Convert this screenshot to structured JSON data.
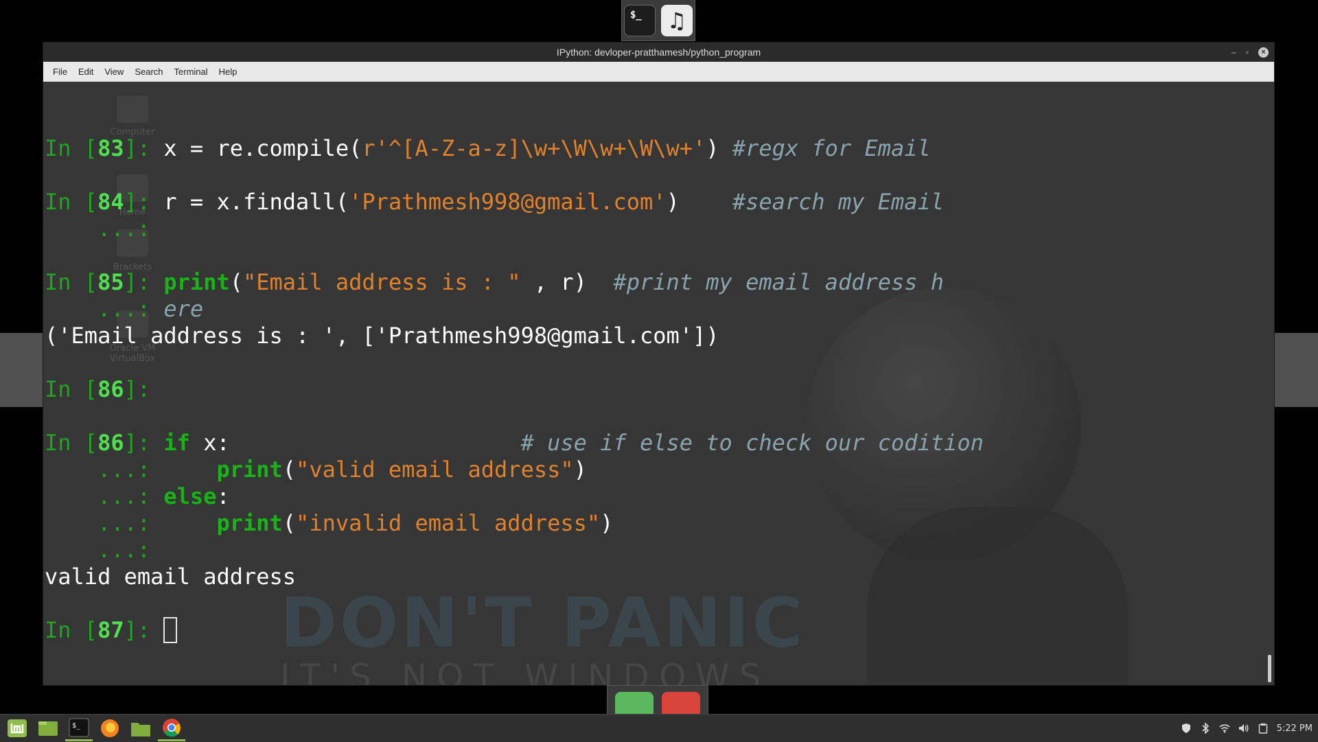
{
  "window": {
    "title": "IPython: devloper-pratthamesh/python_program",
    "controls": {
      "minimize": "–",
      "maximize": "▫",
      "close": "×"
    }
  },
  "menu": [
    "File",
    "Edit",
    "View",
    "Search",
    "Terminal",
    "Help"
  ],
  "desktop_icons": [
    "Computer",
    "Home",
    "Brackets",
    "Oracle VM VirtualBox"
  ],
  "wallpaper": {
    "line1": "DON'T PANIC",
    "line2": "IT'S NOT WINDOWS"
  },
  "terminal": {
    "lines": [
      {
        "parts": []
      },
      {
        "parts": []
      },
      {
        "parts": [
          [
            "p-in",
            "In ["
          ],
          [
            "p-num",
            "83"
          ],
          [
            "p-in",
            "]: "
          ],
          [
            "",
            "x = re.compile("
          ],
          [
            "str",
            "r'^[A-Z-a-z]\\w+\\W\\w+\\W\\w+'"
          ],
          [
            "",
            ") "
          ],
          [
            "cmt",
            "#regx for Email"
          ]
        ]
      },
      {
        "parts": []
      },
      {
        "parts": [
          [
            "p-in",
            "In ["
          ],
          [
            "p-num",
            "84"
          ],
          [
            "p-in",
            "]: "
          ],
          [
            "",
            "r = x.findall("
          ],
          [
            "str",
            "'Prathmesh998@gmail.com'"
          ],
          [
            "",
            ")    "
          ],
          [
            "cmt",
            "#search my Email"
          ]
        ]
      },
      {
        "parts": [
          [
            "p-cont",
            "    ...: "
          ]
        ]
      },
      {
        "parts": []
      },
      {
        "parts": [
          [
            "p-in",
            "In ["
          ],
          [
            "p-num",
            "85"
          ],
          [
            "p-in",
            "]: "
          ],
          [
            "kw",
            "print"
          ],
          [
            "",
            "("
          ],
          [
            "str",
            "\"Email address is : \""
          ],
          [
            "",
            " , r)  "
          ],
          [
            "cmt",
            "#print my email address h"
          ]
        ]
      },
      {
        "parts": [
          [
            "p-cont",
            "    ...: "
          ],
          [
            "cmt",
            "ere"
          ]
        ]
      },
      {
        "parts": [
          [
            "",
            "('Email address is : ', ['Prathmesh998@gmail.com'])"
          ]
        ]
      },
      {
        "parts": []
      },
      {
        "parts": [
          [
            "p-in",
            "In ["
          ],
          [
            "p-num",
            "86"
          ],
          [
            "p-in",
            "]: "
          ]
        ]
      },
      {
        "parts": []
      },
      {
        "parts": [
          [
            "p-in",
            "In ["
          ],
          [
            "p-num",
            "86"
          ],
          [
            "p-in",
            "]: "
          ],
          [
            "kw",
            "if"
          ],
          [
            "",
            " x:                      "
          ],
          [
            "cmt",
            "# use if else to check our codition"
          ]
        ]
      },
      {
        "parts": [
          [
            "p-cont",
            "    ...: "
          ],
          [
            "",
            "    "
          ],
          [
            "kw",
            "print"
          ],
          [
            "",
            "("
          ],
          [
            "str",
            "\"valid email address\""
          ],
          [
            "",
            ")"
          ]
        ]
      },
      {
        "parts": [
          [
            "p-cont",
            "    ...: "
          ],
          [
            "kw",
            "else"
          ],
          [
            "",
            ":"
          ]
        ]
      },
      {
        "parts": [
          [
            "p-cont",
            "    ...: "
          ],
          [
            "",
            "    "
          ],
          [
            "kw",
            "print"
          ],
          [
            "",
            "("
          ],
          [
            "str",
            "\"invalid email address\""
          ],
          [
            "",
            ")"
          ]
        ]
      },
      {
        "parts": [
          [
            "p-cont",
            "    ...: "
          ]
        ]
      },
      {
        "parts": [
          [
            "",
            "valid email address"
          ]
        ]
      },
      {
        "parts": []
      },
      {
        "parts": [
          [
            "p-in",
            "In ["
          ],
          [
            "p-num",
            "87"
          ],
          [
            "p-in",
            "]: "
          ]
        ],
        "cursor": true
      }
    ]
  },
  "taskbar": {
    "items": [
      "mint-menu",
      "show-desktop",
      "terminal",
      "firefox",
      "files",
      "chrome"
    ],
    "clock": "5:22 PM"
  }
}
